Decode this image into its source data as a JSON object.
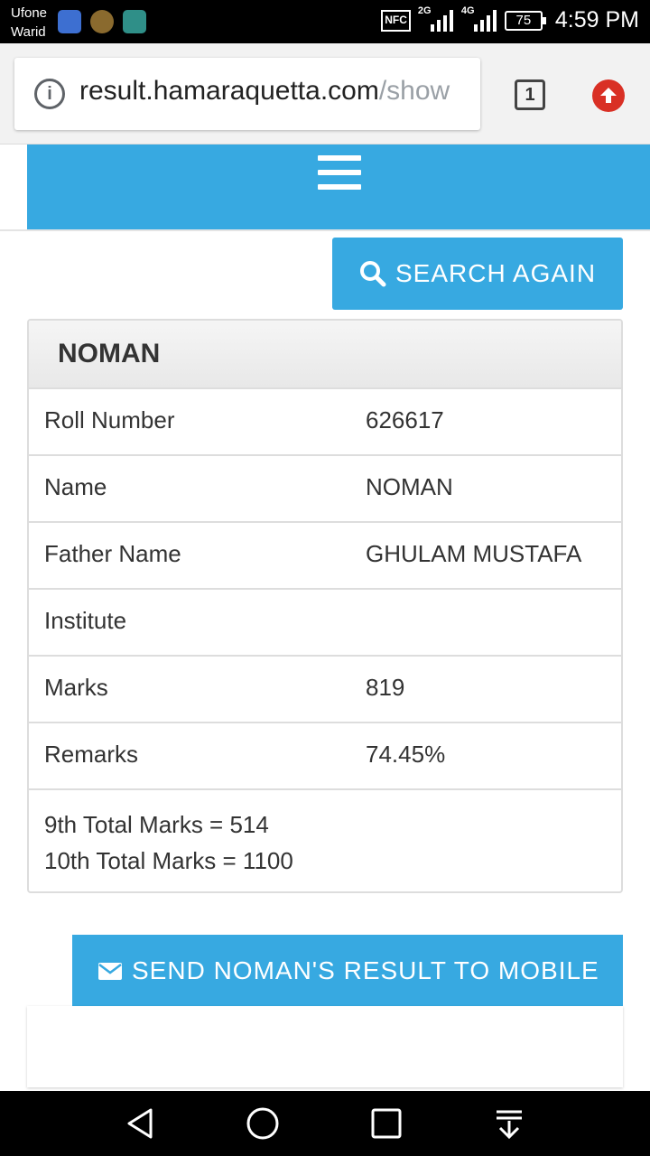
{
  "status_bar": {
    "carrier_1": "Ufone",
    "carrier_2": "Warid",
    "nfc": "NFC",
    "net_1": "2G",
    "net_2": "4G",
    "battery": "75",
    "time": "4:59 PM"
  },
  "browser": {
    "url_main": "result.hamaraquetta.com",
    "url_rest": "/show",
    "tab_count": "1"
  },
  "search": {
    "label": "SEARCH AGAIN"
  },
  "result": {
    "heading": "NOMAN",
    "rows": [
      {
        "label": "Roll Number",
        "value": "626617"
      },
      {
        "label": "Name",
        "value": "NOMAN"
      },
      {
        "label": "Father Name",
        "value": "GHULAM MUSTAFA"
      },
      {
        "label": "Institute",
        "value": ""
      },
      {
        "label": "Marks",
        "value": "819"
      },
      {
        "label": "Remarks",
        "value": "74.45%"
      }
    ],
    "totals": [
      "9th Total Marks = 514",
      "10th Total Marks = 1100"
    ]
  },
  "send": {
    "label": "SEND NOMAN'S RESULT TO MOBILE"
  },
  "colors": {
    "brand_blue": "#37a9e1",
    "update_red": "#d93025"
  },
  "icons": [
    "info-icon",
    "tab-switcher-icon",
    "update-icon",
    "menu-icon",
    "search-icon",
    "envelope-icon",
    "back-icon",
    "home-icon",
    "recents-icon",
    "notifications-icon"
  ]
}
